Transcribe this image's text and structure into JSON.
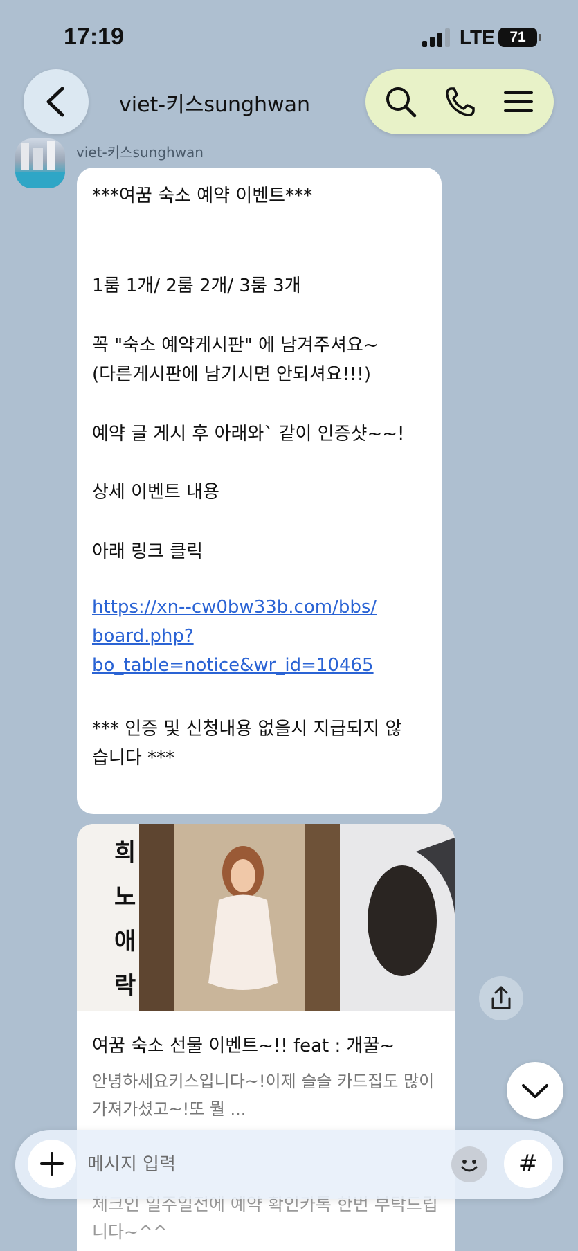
{
  "status_bar": {
    "time": "17:19",
    "network": "LTE",
    "battery": "71"
  },
  "header": {
    "title": "viet-키스sunghwan"
  },
  "sender": {
    "name": "viet-키스sunghwan"
  },
  "message": {
    "lines": [
      "***여꿈 숙소 예약 이벤트***",
      "1룸 1개/ 2룸 2개/ 3룸 3개",
      "꼭 \"숙소 예약게시판\" 에 남겨주셔요~",
      "(다른게시판에 남기시면 안되셔요!!!)",
      "예약 글 게시 후 아래와` 같이 인증샷~~!",
      "상세 이벤트 내용",
      "아래 링크 클릭",
      "*** 인증 및 신청내용 없을시 지급되지 않",
      "습니다 ***"
    ],
    "link_lines": [
      "https://xn--cw0bw33b.com/bbs/",
      "board.php?",
      "bo_table=notice&wr_id=10465"
    ]
  },
  "link_card": {
    "image_text": [
      "희",
      "노",
      "애",
      "락"
    ],
    "title": "여꿈 숙소 선물 이벤트~!! feat : 개꿀~",
    "description": "안녕하세요키스입니다~!이제 슬슬 카드집도 많이 가져가셨고~!또 뭘 ...",
    "extra": "체크인 일주일전에 예약 확인카톡 한번 부탁드립니다~^^"
  },
  "input": {
    "placeholder": "메시지 입력",
    "hash_label": "#"
  },
  "colors": {
    "background": "#aebfd0",
    "link": "#2a63d4",
    "actions_pill": "#e8f2c8"
  }
}
